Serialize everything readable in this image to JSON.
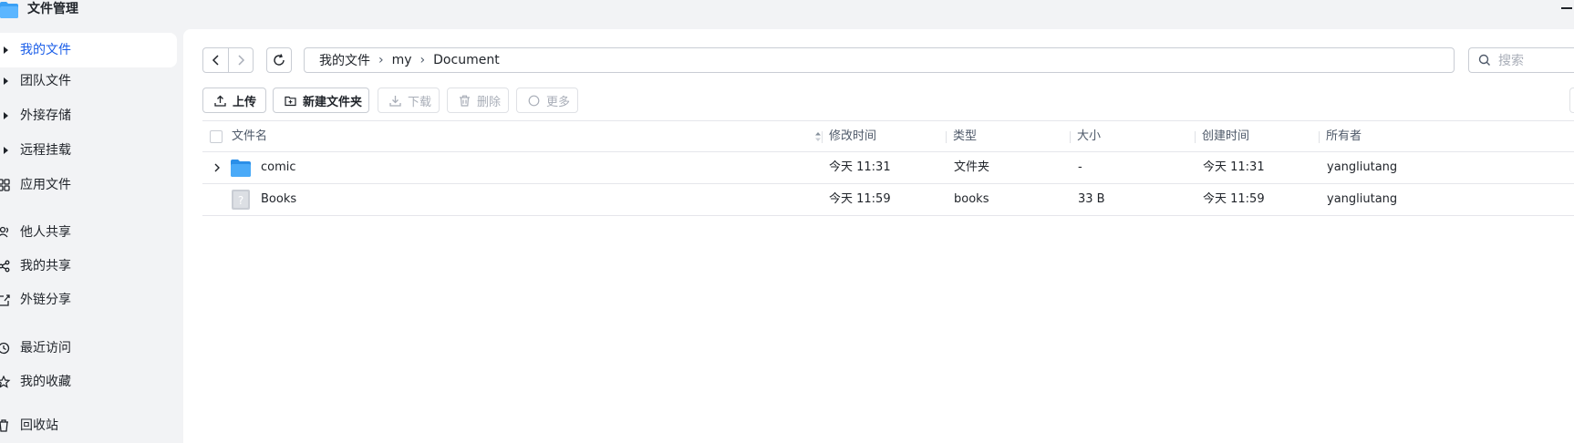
{
  "app": {
    "title": "文件管理",
    "colors": {
      "accent": "#1b5ee8",
      "folder": "#3aa0f5",
      "sidebar_bg": "#f2f3f5"
    }
  },
  "sidebar": {
    "items": [
      {
        "label": "我的文件",
        "icon": "caret-right-icon",
        "active": true
      },
      {
        "label": "团队文件",
        "icon": "caret-right-icon"
      },
      {
        "label": "外接存储",
        "icon": "caret-right-icon"
      },
      {
        "label": "远程挂载",
        "icon": "caret-right-icon"
      },
      {
        "label": "应用文件",
        "icon": "apps-grid-icon"
      },
      {
        "label": "他人共享",
        "icon": "users-icon"
      },
      {
        "label": "我的共享",
        "icon": "share-icon"
      },
      {
        "label": "外链分享",
        "icon": "external-link-icon"
      },
      {
        "label": "最近访问",
        "icon": "clock-icon"
      },
      {
        "label": "我的收藏",
        "icon": "star-icon"
      },
      {
        "label": "回收站",
        "icon": "trash-icon"
      }
    ]
  },
  "breadcrumb": [
    "我的文件",
    "my",
    "Document"
  ],
  "search": {
    "placeholder": "搜索"
  },
  "toolbar": {
    "upload": "上传",
    "new_folder": "新建文件夹",
    "download": "下载",
    "delete": "删除",
    "more": "更多"
  },
  "table": {
    "columns": [
      "文件名",
      "修改时间",
      "类型",
      "大小",
      "创建时间",
      "所有者"
    ],
    "rows": [
      {
        "name": "comic",
        "modified": "今天 11:31",
        "type": "文件夹",
        "size": "-",
        "created": "今天 11:31",
        "owner": "yangliutang",
        "icon": "folder-icon"
      },
      {
        "name": "Books",
        "modified": "今天 11:59",
        "type": "books",
        "size": "33 B",
        "created": "今天 11:59",
        "owner": "yangliutang",
        "icon": "unknown-file-icon"
      }
    ]
  }
}
